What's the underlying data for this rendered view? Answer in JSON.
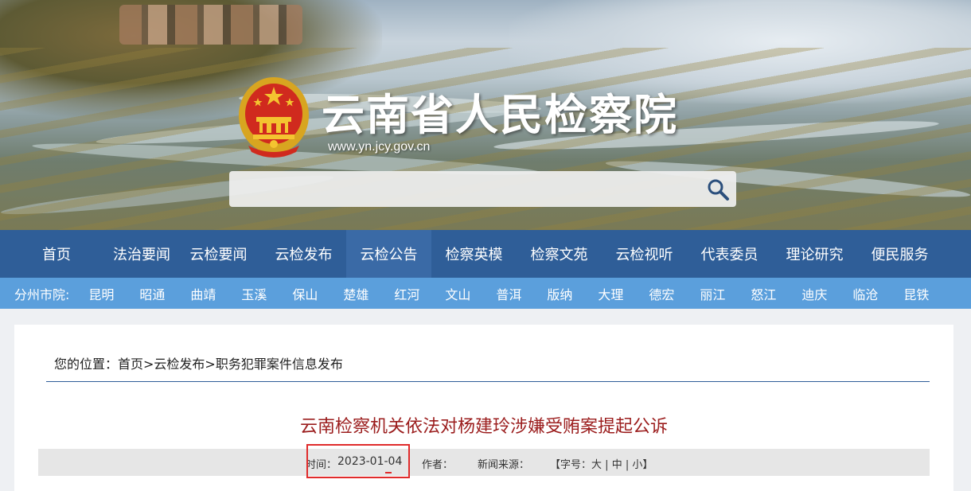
{
  "header": {
    "site_title": "云南省人民检察院",
    "site_url": "www.yn.jcy.gov.cn",
    "search": {
      "placeholder": ""
    }
  },
  "nav": {
    "items": [
      "首页",
      "法治要闻",
      "云检要闻",
      "云检发布",
      "云检公告",
      "检察英模",
      "检察文苑",
      "云检视听",
      "代表委员",
      "理论研究",
      "便民服务"
    ],
    "active_index": 4
  },
  "subnav": {
    "label": "分州市院:",
    "items": [
      "昆明",
      "昭通",
      "曲靖",
      "玉溪",
      "保山",
      "楚雄",
      "红河",
      "文山",
      "普洱",
      "版纳",
      "大理",
      "德宏",
      "丽江",
      "怒江",
      "迪庆",
      "临沧",
      "昆铁"
    ]
  },
  "article": {
    "breadcrumb": "您的位置：首页>云检发布>职务犯罪案件信息发布",
    "title": "云南检察机关依法对杨建玲涉嫌受贿案提起公诉",
    "time_label": "时间：",
    "time_value": "2023-01-04",
    "author_label": "作者：",
    "source_label": "新闻来源：",
    "font_size_open": "【字号：",
    "font_size_large": "大",
    "font_size_medium": "中",
    "font_size_small": "小",
    "font_size_close": "】",
    "separator": "|"
  },
  "colors": {
    "nav_bg": "#2f5e98",
    "nav_active_bg": "#3a6aa6",
    "subnav_bg": "#5b9fdc",
    "title_red": "#9b1d1d",
    "highlight_red": "#e02b2b"
  }
}
